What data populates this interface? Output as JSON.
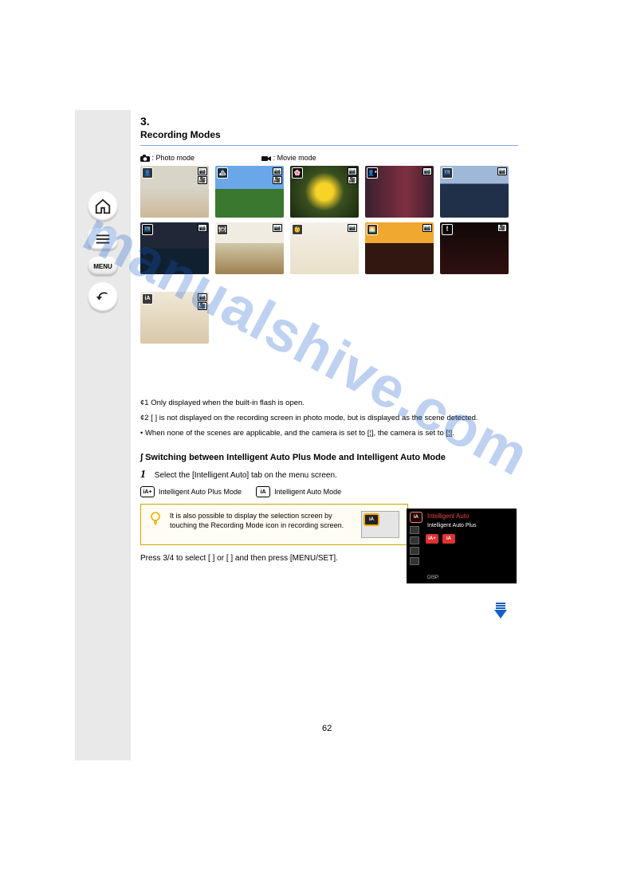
{
  "page": {
    "number": "62",
    "title": "3.",
    "subtitle": "Recording Modes"
  },
  "watermark": "manualshive.com",
  "side_nav": {
    "menu_label": "MENU"
  },
  "header_row": {
    "photo_label": ": Photo mode",
    "movie_label": ": Movie mode"
  },
  "scenes": [
    {
      "badge_text": "",
      "name": "i-Portrait"
    },
    {
      "badge_text": "",
      "name": "i-Scenery"
    },
    {
      "badge_text": "",
      "name": "i-Macro"
    },
    {
      "badge_text": "",
      "name": "i-Night Portrait"
    },
    {
      "badge_text": "",
      "name": "i-Night Scenery"
    },
    {
      "badge_text": "",
      "name": "i-Handheld Night Shot"
    },
    {
      "badge_text": "",
      "name": "i-Food"
    },
    {
      "badge_text": "",
      "name": "i-Baby"
    },
    {
      "badge_text": "",
      "name": "i-Sunset"
    },
    {
      "badge_text": "",
      "name": "i-Low Light"
    },
    {
      "badge_text": "",
      "name": ""
    }
  ],
  "scene_note": "¢1 Only displayed when the built-in flash is open.",
  "scene_note2": "¢2 [ ] is not displayed on the recording screen in photo mode, but is displayed as the scene detected.",
  "body_para": "• When none of the scenes are applicable, and the camera is set to [¦], the camera is set to [¦].",
  "section2": {
    "heading": "∫ Switching between Intelligent Auto Plus Mode and Intelligent Auto Mode",
    "step1_num": "1",
    "step1": "Select the [Intelligent Auto] tab on the menu screen.",
    "step2": "Press 3/4 to select [      ] or [      ] and then press [MENU/SET].",
    "modes": [
      {
        "icon": "iA+",
        "label": "Intelligent Auto Plus Mode"
      },
      {
        "icon": "iA",
        "label": "Intelligent Auto Mode"
      }
    ],
    "tip": "It is also possible to display the selection screen by touching the Recording Mode icon in recording screen."
  },
  "camera_ui": {
    "title": "Intelligent Auto",
    "subtitle": "Intelligent Auto Plus",
    "chip1": "iA+",
    "chip2": "iA",
    "footer": "DISP."
  }
}
